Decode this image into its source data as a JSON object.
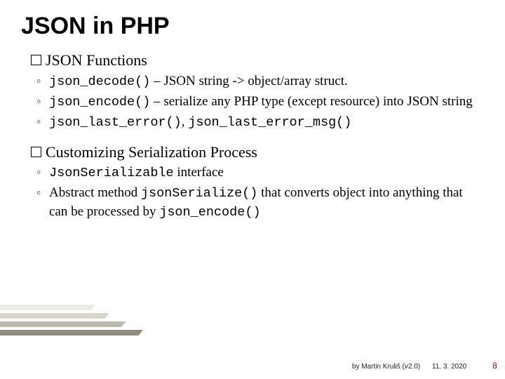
{
  "title": "JSON in PHP",
  "section1": {
    "heading": "JSON Functions",
    "items": [
      {
        "code": "json_decode()",
        "text": " – JSON string -> object/array struct."
      },
      {
        "code": "json_encode()",
        "text": " – serialize any PHP type (except resource) into JSON string"
      },
      {
        "code": "json_last_error()",
        "text2_prefix": ", ",
        "code2": "json_last_error_msg()"
      }
    ]
  },
  "section2": {
    "heading": "Customizing Serialization Process",
    "items": [
      {
        "code": "JsonSerializable",
        "text": " interface"
      },
      {
        "text_pre": "Abstract method ",
        "code": "jsonSerialize()",
        "text": " that converts object into anything that can be processed by ",
        "code2": "json_encode()"
      }
    ]
  },
  "footer": {
    "author": "by Martin Kruliš (v2.0)",
    "date": "11. 3. 2020",
    "page": "8"
  }
}
